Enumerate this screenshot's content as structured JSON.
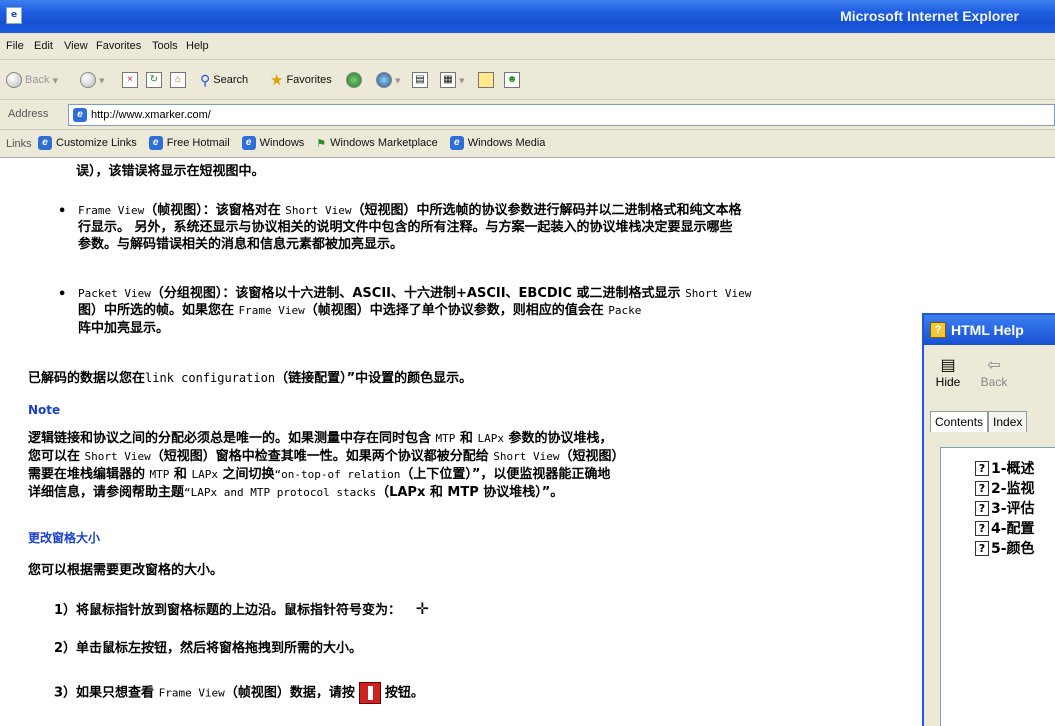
{
  "window": {
    "title": "Microsoft Internet Explorer"
  },
  "menu": [
    "File",
    "Edit",
    "View",
    "Favorites",
    "Tools",
    "Help"
  ],
  "toolbar": {
    "back": "Back",
    "search": "Search",
    "favorites": "Favorites"
  },
  "address": {
    "label": "Address",
    "url": "http://www.xmarker.com/"
  },
  "links": {
    "label": "Links",
    "items": [
      "Customize Links",
      "Free Hotmail",
      "Windows",
      "Windows Marketplace",
      "Windows Media"
    ]
  },
  "content": {
    "line0": "误），该错误将显示在短视图中。",
    "bullet1": {
      "term": "Frame View",
      "line1": "（帧视图）：该窗格对在 ",
      "sv": "Short View",
      "line1b": "（短视图）中所选帧的协议参数进行解码并以二进制格式和纯文本格",
      "line2": "行显示。 另外，系统还显示与协议相关的说明文件中包含的所有注释。与方案一起装入的协议堆栈决定要显示哪些",
      "line3": "参数。与解码错误相关的消息和信息元素都被加亮显示。"
    },
    "bullet2": {
      "term": "Packet View",
      "line1": "（分组视图）：该窗格以十六进制、ASCII、十六进制+ASCII、EBCDIC 或二进制格式显示 ",
      "sv": "Short View",
      "line2a": "图）中所选的帧。如果您在 ",
      "fv": "Frame View",
      "line2b": "（帧视图）中选择了单个协议参数，则相应的值会在 ",
      "pv": "Packe",
      "line3": "阵中加亮显示。"
    },
    "decoded_a": "已解码的数据以您在",
    "decoded_link": "link configuration",
    "decoded_b": "（链接配置）”中设置的颜色显示。",
    "note_label": "Note",
    "note1a": "逻辑链接和协议之间的分配必须总是唯一的。如果测量中存在同时包含 ",
    "mtp": "MTP",
    "and": " 和 ",
    "lapx": "LAPx",
    "note1b": " 参数的协议堆栈，",
    "note2a": "您可以在 ",
    "note2sv": "Short View",
    "note2b": "（短视图）窗格中检查其唯一性。如果两个协议都被分配给 ",
    "note2sv2": "Short View",
    "note2c": "（短视图）",
    "note3a": "需要在堆栈编辑器的 ",
    "note3b": " 之间切换",
    "note3link": "“on-top-of relation",
    "note3c": "（上下位置）”，以便监视器能正确地",
    "note4a": "详细信息，请参阅帮助主题",
    "note4link": "“LAPx and MTP protocol stacks",
    "note4b": "（LAPx 和 MTP 协议堆栈）”。",
    "resize_heading": "更改窗格大小",
    "resize_intro": "您可以根据需要更改窗格的大小。",
    "step1": "1）将鼠标指针放到窗格标题的上边沿。鼠标指针符号变为：",
    "step1_glyph": "✛",
    "step2": "2）单击鼠标左按钮，然后将窗格拖拽到所需的大小。",
    "step3a": "3）如果只想查看 ",
    "step3fv": "Frame View",
    "step3b": "（帧视图）数据，请按",
    "step3c": "按钮。"
  },
  "help": {
    "title": "HTML Help",
    "hide": "Hide",
    "back": "Back",
    "tabs": [
      "Contents",
      "Index"
    ],
    "items": [
      "1-概述",
      "2-监视",
      "3-评估",
      "4-配置",
      "5-颜色"
    ]
  }
}
